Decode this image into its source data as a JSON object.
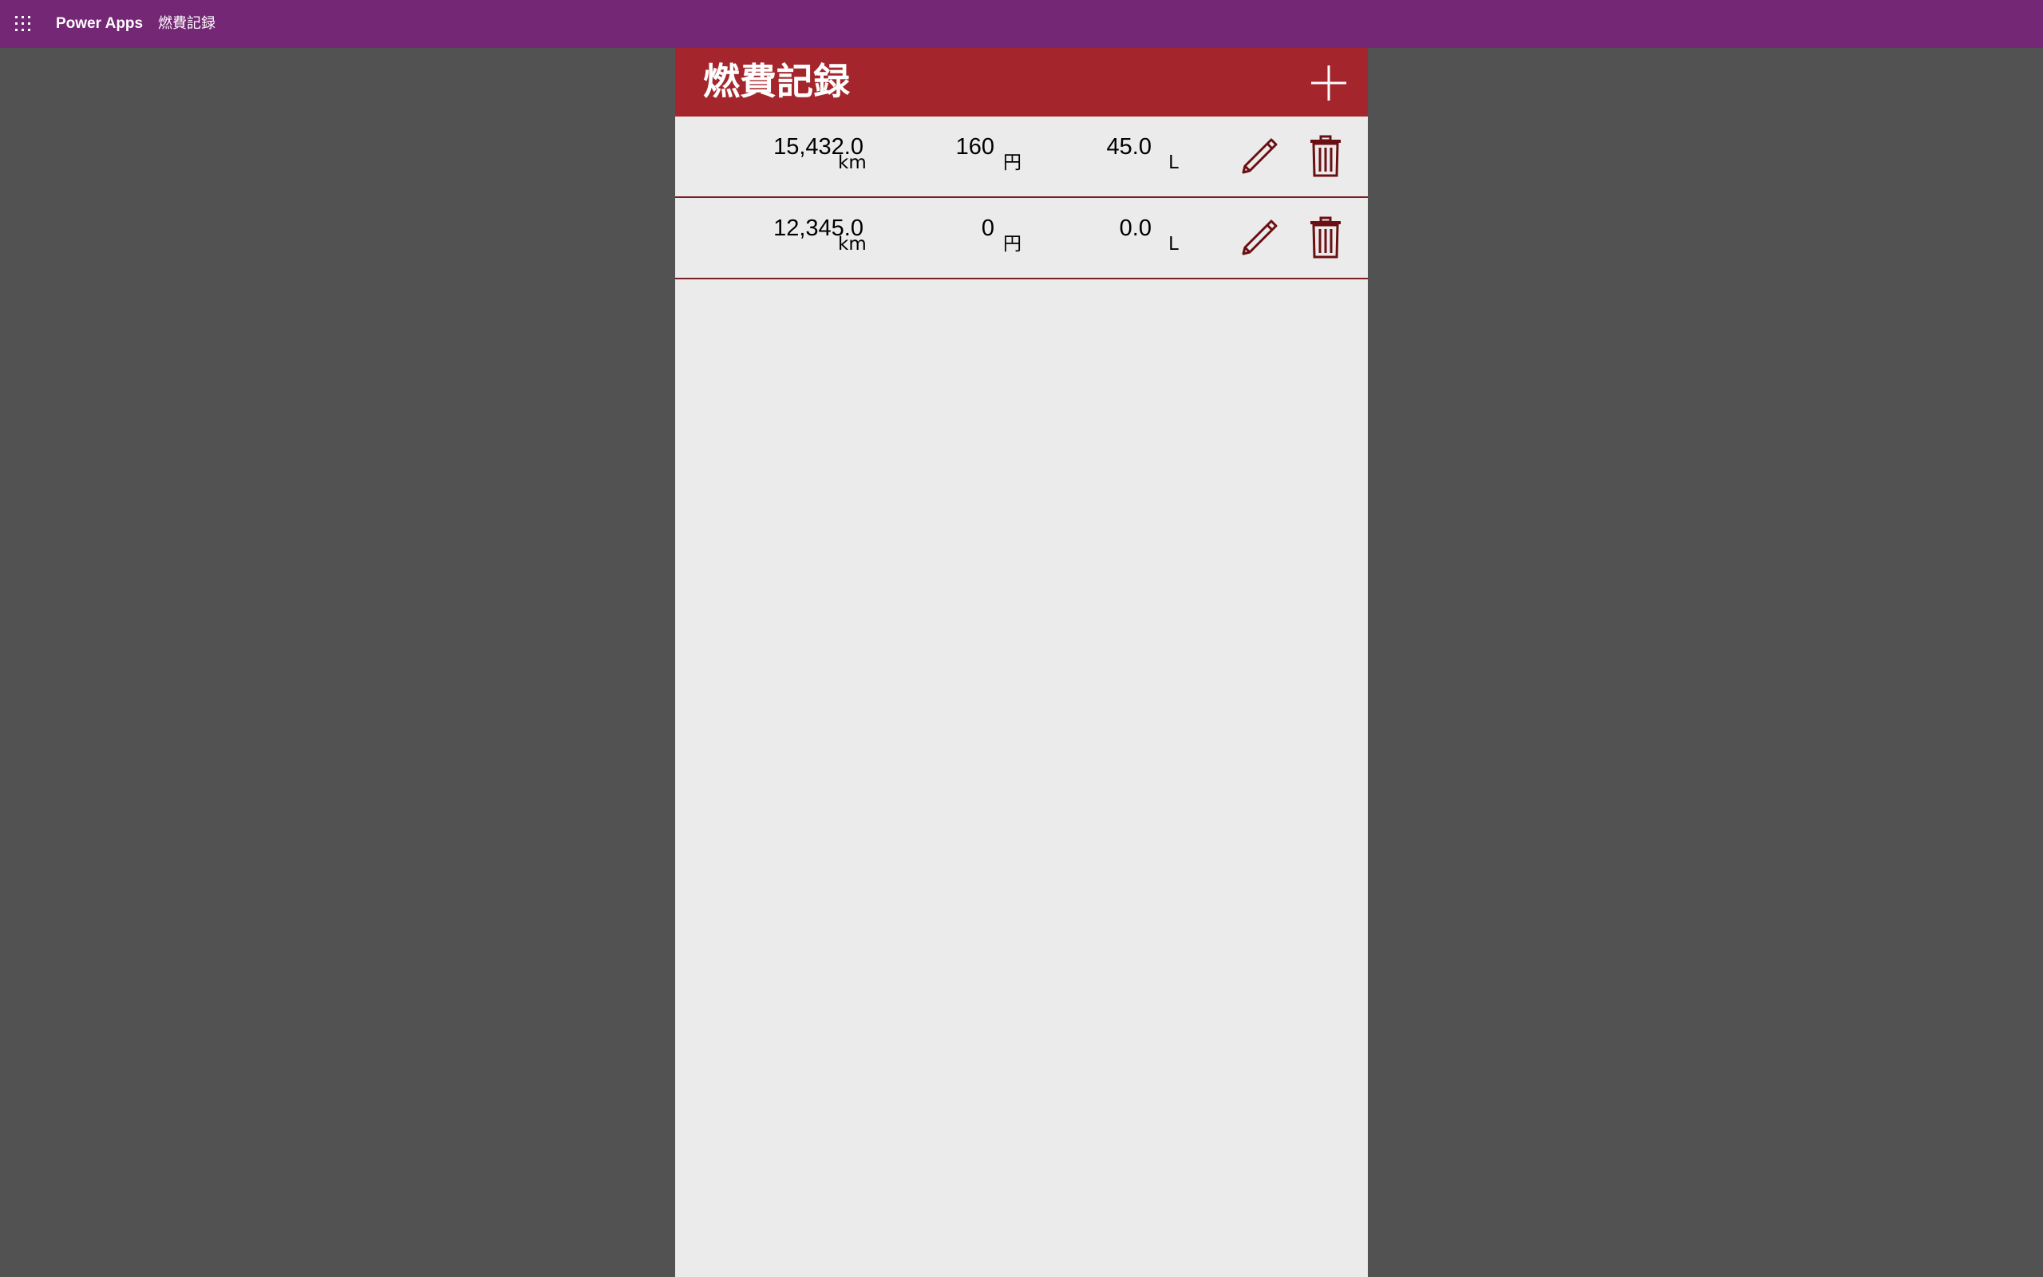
{
  "topbar": {
    "brand": "Power Apps",
    "app_name": "燃費記録"
  },
  "header": {
    "title": "燃費記録"
  },
  "records": [
    {
      "distance": "15,432.0",
      "distance_unit": "km",
      "price": "160",
      "price_unit": "円",
      "volume": "45.0",
      "volume_unit": "L"
    },
    {
      "distance": "12,345.0",
      "distance_unit": "km",
      "price": "0",
      "price_unit": "円",
      "volume": "0.0",
      "volume_unit": "L"
    }
  ],
  "colors": {
    "topbar": "#742774",
    "header": "#a4262c",
    "icon": "#6b0f12",
    "background": "#525252",
    "canvas": "#ebebeb"
  },
  "icons": {
    "waffle": "waffle-icon",
    "add": "add-icon",
    "edit": "pencil-icon",
    "delete": "trash-icon"
  }
}
